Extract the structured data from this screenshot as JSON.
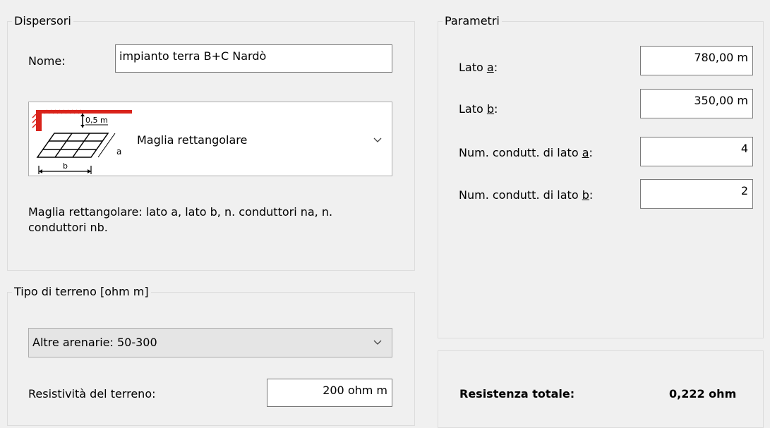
{
  "dispersori": {
    "legend": "Dispersori",
    "nome_label": "Nome:",
    "nome_value": "impianto terra B+C Nardò",
    "type_selected": "Maglia rettangolare",
    "diagram": {
      "depth_label": "0,5 m",
      "side_a_label": "a",
      "side_b_label": "b"
    },
    "description": "Maglia rettangolare: lato a, lato b, n. conduttori na, n. conduttori nb."
  },
  "terreno": {
    "legend": "Tipo di terreno [ohm m]",
    "selected": "Altre arenarie: 50-300",
    "resistivita_label": "Resistività del terreno:",
    "resistivita_value": "200 ohm m"
  },
  "parametri": {
    "legend": "Parametri",
    "lato_a": {
      "prefix": "Lato ",
      "key": "a",
      "suffix": ":",
      "value": "780,00 m"
    },
    "lato_b": {
      "prefix": "Lato ",
      "key": "b",
      "suffix": ":",
      "value": "350,00 m"
    },
    "num_a": {
      "prefix": "Num. condutt. di lato ",
      "key": "a",
      "suffix": ":",
      "value": "4"
    },
    "num_b": {
      "prefix": "Num. condutt. di lato ",
      "key": "b",
      "suffix": ":",
      "value": "2"
    }
  },
  "risultato": {
    "label": "Resistenza totale:",
    "value": "0,222 ohm"
  },
  "icons": [
    "chevron-down-icon",
    "ground-mesh-diagram-icon"
  ]
}
